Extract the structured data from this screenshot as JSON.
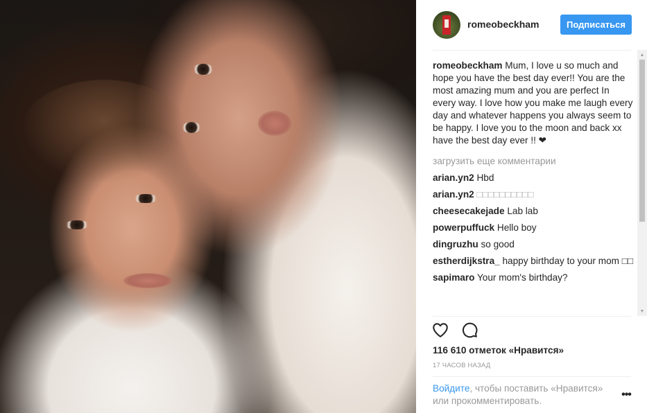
{
  "post": {
    "username": "romeobeckham",
    "follow_label": "Подписаться"
  },
  "caption": {
    "author": "romeobeckham",
    "text": " Mum, I love u so much and hope you have the best day ever!! You are the most amazing mum and you are perfect In every way. I love how you make me laugh every day and whatever happens you always seem to be happy. I love you to the moon and back xx have the best day ever !! ❤"
  },
  "load_more_label": "загрузить еще комментарии",
  "comments": [
    {
      "author": "arian.yn2",
      "text": " Hbd"
    },
    {
      "author": "arian.yn2",
      "text": " □□□□□□□□□□"
    },
    {
      "author": "cheesecakejade",
      "text": " Lab lab"
    },
    {
      "author": "powerpuffuck",
      "text": " Hello boy"
    },
    {
      "author": "dingruzhu",
      "text": " so good"
    },
    {
      "author": "estherdijkstra_",
      "text": " happy birthday to your mom □□"
    },
    {
      "author": "sapimaro",
      "text": " Your mom's birthday?"
    }
  ],
  "likes_label": "116 610 отметок «Нравится»",
  "timestamp": "17 ЧАСОВ НАЗАД",
  "login": {
    "link_label": "Войдите",
    "rest_text": ", чтобы поставить «Нравится» или прокомментировать."
  },
  "more_label": "•••",
  "icons": {
    "like": "heart-outline",
    "comment": "speech-bubble-outline",
    "more": "horizontal-dots"
  },
  "colors": {
    "accent": "#3897f0",
    "muted": "#999999",
    "text": "#262626"
  }
}
